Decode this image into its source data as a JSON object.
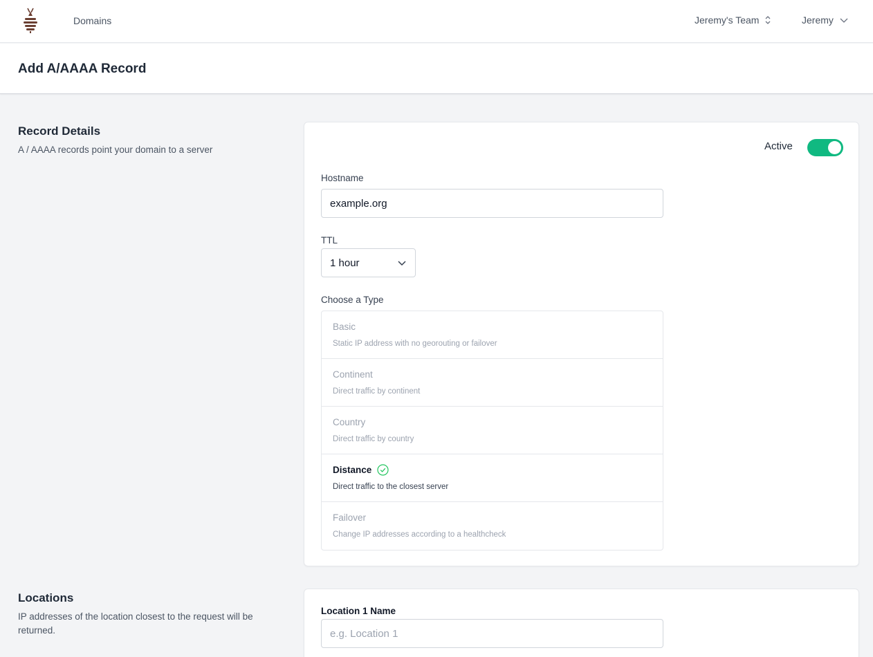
{
  "nav": {
    "domains_label": "Domains",
    "team_label": "Jeremy's Team",
    "user_label": "Jeremy"
  },
  "page": {
    "title": "Add A/AAAA Record"
  },
  "record_details": {
    "title": "Record Details",
    "description": "A / AAAA records point your domain to a server",
    "active_label": "Active",
    "active": true,
    "hostname_label": "Hostname",
    "hostname_value": "example.org",
    "ttl_label": "TTL",
    "ttl_value": "1 hour",
    "type_label": "Choose a Type",
    "types": [
      {
        "name": "Basic",
        "desc": "Static IP address with no georouting or failover"
      },
      {
        "name": "Continent",
        "desc": "Direct traffic by continent"
      },
      {
        "name": "Country",
        "desc": "Direct traffic by country"
      },
      {
        "name": "Distance",
        "desc": "Direct traffic to the closest server"
      },
      {
        "name": "Failover",
        "desc": "Change IP addresses according to a healthcheck"
      }
    ],
    "selected_type": "Distance"
  },
  "locations": {
    "title": "Locations",
    "description": "IP addresses of the location closest to the request will be returned.",
    "location1_label": "Location 1 Name",
    "location1_placeholder": "e.g. Location 1",
    "location1_value": ""
  },
  "colors": {
    "accent": "#10b981",
    "check": "#22c55e",
    "logo": "#6b3f32"
  }
}
